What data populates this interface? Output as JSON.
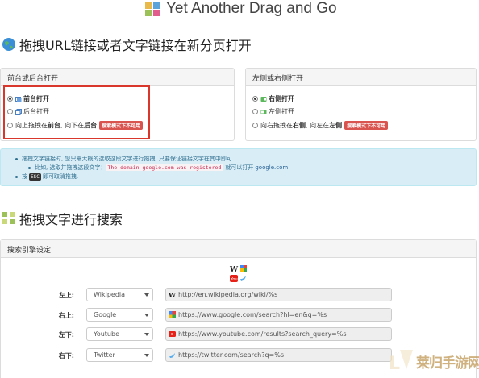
{
  "app": {
    "title": "Yet Another Drag and Go"
  },
  "sections": {
    "url": {
      "title": "拖拽URL链接或者文字链接在新分页打开"
    },
    "text": {
      "title": "拖拽文字进行搜索"
    }
  },
  "panels": {
    "tab_position": {
      "title": "前台或后台打开",
      "options": [
        {
          "label": "前台打开",
          "selected": true
        },
        {
          "label": "后台打开",
          "selected": false
        }
      ],
      "drag_option": {
        "prefix": "向上拖拽在",
        "mid_bold": "前台",
        "mid": ", 向下在",
        "end_bold": "后台",
        "badge": "搜索模式下不可用"
      }
    },
    "tab_side": {
      "title": "左侧或右侧打开",
      "options": [
        {
          "label": "右侧打开",
          "selected": true
        },
        {
          "label": "左侧打开",
          "selected": false
        }
      ],
      "drag_option": {
        "prefix": "向右拖拽在",
        "mid_bold": "右侧",
        "mid": ", 向左在",
        "end_bold": "左侧",
        "badge": "搜索模式下不可用"
      }
    }
  },
  "info": {
    "line1": "拖拽文字链接时, 您只需大概的选取这段文字进行拖拽, 只要保证链接文字在其中即可.",
    "line2_prefix": "比如, 选取并拖拽这段文字：",
    "line2_code": "The domain google.com was registered",
    "line2_suffix": "就可以打开",
    "line2_link": "google.com.",
    "line3_prefix": "按",
    "line3_key": "ESC",
    "line3_suffix": "即可取消拖拽."
  },
  "engine_panel": {
    "title": "搜索引擎设定",
    "rows": [
      {
        "label": "左上:",
        "engine": "Wikipedia",
        "url": "http://en.wikipedia.org/wiki/%s",
        "icon": "wikipedia-icon"
      },
      {
        "label": "右上:",
        "engine": "Google",
        "url": "https://www.google.com/search?hl=en&q=%s",
        "icon": "google-icon"
      },
      {
        "label": "左下:",
        "engine": "Youtube",
        "url": "https://www.youtube.com/results?search_query=%s",
        "icon": "youtube-icon"
      },
      {
        "label": "右下:",
        "engine": "Twitter",
        "url": "https://twitter.com/search?q=%s",
        "icon": "twitter-icon"
      }
    ]
  },
  "watermark": {
    "text": "莱归手游网"
  },
  "colors": {
    "highlight": "#d9372c",
    "badge": "#d9534f",
    "info_bg": "#d9edf7",
    "info_text": "#31708f",
    "code_text": "#c7254e"
  }
}
